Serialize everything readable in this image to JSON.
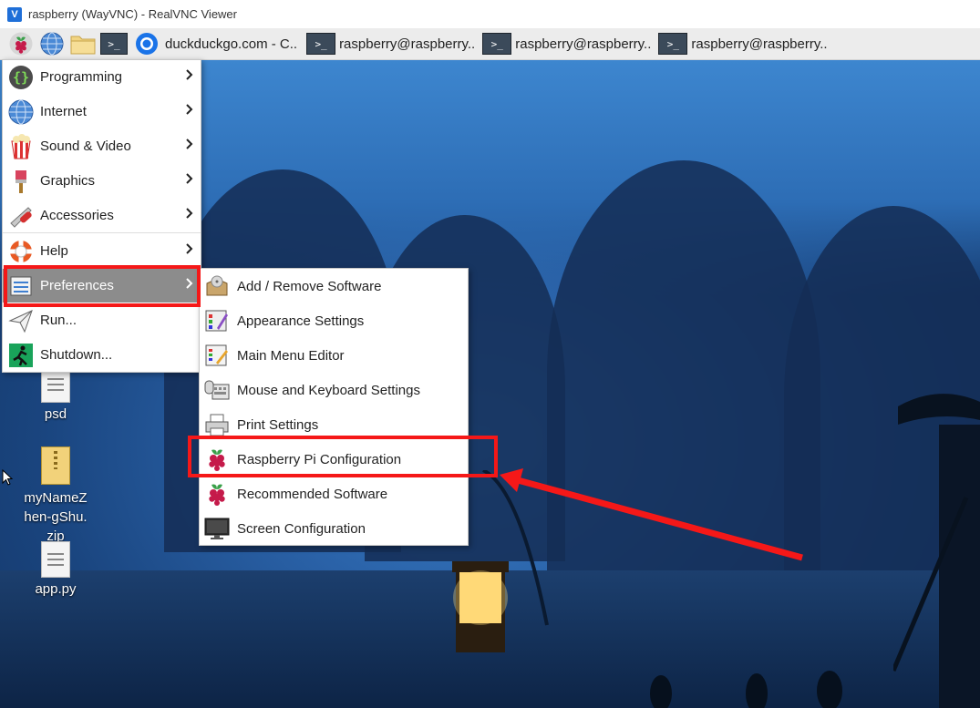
{
  "window": {
    "title": "raspberry (WayVNC) - RealVNC Viewer"
  },
  "taskbar": {
    "tasks": [
      {
        "label": "duckduckgo.com - C..",
        "icon": "browser-icon"
      },
      {
        "label": "raspberry@raspberry..",
        "icon": "terminal-icon"
      },
      {
        "label": "raspberry@raspberry..",
        "icon": "terminal-icon"
      },
      {
        "label": "raspberry@raspberry..",
        "icon": "terminal-icon"
      }
    ],
    "terminal_glyph": ">_"
  },
  "menu": {
    "items": [
      {
        "label": "Programming",
        "icon": "programming-icon"
      },
      {
        "label": "Internet",
        "icon": "globe-icon"
      },
      {
        "label": "Sound & Video",
        "icon": "popcorn-icon"
      },
      {
        "label": "Graphics",
        "icon": "paintbrush-icon"
      },
      {
        "label": "Accessories",
        "icon": "swiss-knife-icon"
      },
      {
        "label": "Help",
        "icon": "lifebuoy-icon"
      },
      {
        "label": "Preferences",
        "icon": "preferences-icon"
      },
      {
        "label": "Run...",
        "icon": "paper-plane-icon"
      },
      {
        "label": "Shutdown...",
        "icon": "exit-icon"
      }
    ]
  },
  "submenu": {
    "items": [
      {
        "label": "Add / Remove Software",
        "icon": "package-icon"
      },
      {
        "label": "Appearance Settings",
        "icon": "appearance-icon"
      },
      {
        "label": "Main Menu Editor",
        "icon": "menu-editor-icon"
      },
      {
        "label": "Mouse and Keyboard Settings",
        "icon": "keyboard-mouse-icon"
      },
      {
        "label": "Print Settings",
        "icon": "printer-icon"
      },
      {
        "label": "Raspberry Pi Configuration",
        "icon": "raspberry-icon"
      },
      {
        "label": "Recommended Software",
        "icon": "raspberry-icon"
      },
      {
        "label": "Screen Configuration",
        "icon": "monitor-icon"
      }
    ]
  },
  "desktop": {
    "icons": [
      {
        "label": "psd"
      },
      {
        "label": "myNameZhen-gShu.zip"
      },
      {
        "label": "app.py"
      }
    ]
  },
  "colors": {
    "highlight": "#f51818",
    "menu_active": "#8c8c8c"
  }
}
